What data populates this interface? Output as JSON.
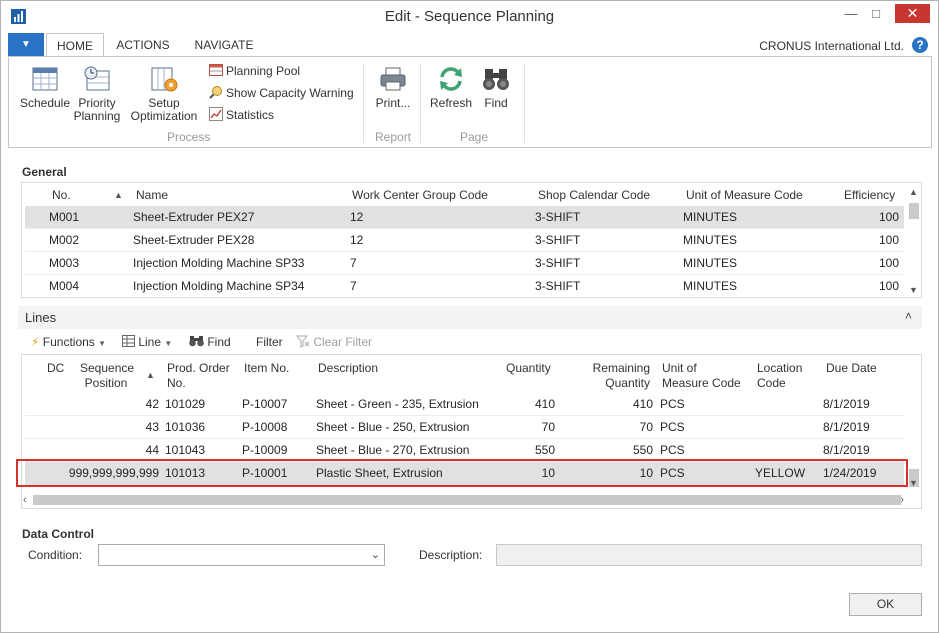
{
  "window": {
    "title": "Edit - Sequence Planning",
    "minimize_glyph": "—",
    "maximize_glyph": "□",
    "close_glyph": "✕"
  },
  "ribbon": {
    "file_glyph": "▼",
    "tabs": [
      "HOME",
      "ACTIONS",
      "NAVIGATE"
    ],
    "company": "CRONUS International Ltd.",
    "help_glyph": "?",
    "process": {
      "schedule": "Schedule",
      "priority_line1": "Priority",
      "priority_line2": "Planning",
      "setup_line1": "Setup",
      "setup_line2": "Optimization",
      "planning_pool": "Planning Pool",
      "show_capacity_warning": "Show Capacity Warning",
      "statistics": "Statistics",
      "group_label": "Process"
    },
    "report": {
      "print": "Print...",
      "group_label": "Report"
    },
    "page": {
      "refresh": "Refresh",
      "find": "Find",
      "group_label": "Page"
    }
  },
  "general": {
    "title": "General",
    "columns": [
      "No.",
      "Name",
      "Work Center Group Code",
      "Shop Calendar Code",
      "Unit of Measure Code",
      "Efficiency"
    ],
    "rows": [
      {
        "no": "M001",
        "name": "Sheet-Extruder PEX27",
        "wcg": "12",
        "cal": "3-SHIFT",
        "uom": "MINUTES",
        "eff": "100"
      },
      {
        "no": "M002",
        "name": "Sheet-Extruder PEX28",
        "wcg": "12",
        "cal": "3-SHIFT",
        "uom": "MINUTES",
        "eff": "100"
      },
      {
        "no": "M003",
        "name": "Injection Molding Machine SP33",
        "wcg": "7",
        "cal": "3-SHIFT",
        "uom": "MINUTES",
        "eff": "100"
      },
      {
        "no": "M004",
        "name": "Injection Molding Machine SP34",
        "wcg": "7",
        "cal": "3-SHIFT",
        "uom": "MINUTES",
        "eff": "100"
      }
    ]
  },
  "lines": {
    "title": "Lines",
    "collapse_glyph": "˄",
    "toolbar": {
      "functions": "Functions",
      "line": "Line",
      "find": "Find",
      "filter": "Filter",
      "clear_filter": "Clear Filter"
    },
    "columns": {
      "dc": "DC",
      "seq_line1": "Sequence",
      "seq_line2": "Position",
      "prod_line1": "Prod. Order",
      "prod_line2": "No.",
      "item": "Item No.",
      "desc": "Description",
      "qty": "Quantity",
      "rem_line1": "Remaining",
      "rem_line2": "Quantity",
      "uom_line1": "Unit of",
      "uom_line2": "Measure Code",
      "loc_line1": "Location",
      "loc_line2": "Code",
      "due": "Due Date"
    },
    "rows": [
      {
        "dc": "",
        "seq": "42",
        "prod": "101029",
        "item": "P-10007",
        "desc": "Sheet - Green - 235, Extrusion",
        "qty": "410",
        "rem": "410",
        "uom": "PCS",
        "loc": "",
        "due": "8/1/2019"
      },
      {
        "dc": "",
        "seq": "43",
        "prod": "101036",
        "item": "P-10008",
        "desc": "Sheet - Blue - 250, Extrusion",
        "qty": "70",
        "rem": "70",
        "uom": "PCS",
        "loc": "",
        "due": "8/1/2019"
      },
      {
        "dc": "",
        "seq": "44",
        "prod": "101043",
        "item": "P-10009",
        "desc": "Sheet - Blue - 270, Extrusion",
        "qty": "550",
        "rem": "550",
        "uom": "PCS",
        "loc": "",
        "due": "8/1/2019"
      },
      {
        "dc": "",
        "seq": "999,999,999,999",
        "prod": "101013",
        "item": "P-10001",
        "desc": "Plastic Sheet, Extrusion",
        "qty": "10",
        "rem": "10",
        "uom": "PCS",
        "loc": "YELLOW",
        "due": "1/24/2019"
      }
    ]
  },
  "data_control": {
    "title": "Data Control",
    "condition_label": "Condition:",
    "condition_value": "",
    "description_label": "Description:",
    "description_value": ""
  },
  "ok_label": "OK",
  "colors": {
    "accent": "#2a73c4",
    "close": "#c7372f",
    "highlight_border": "#d9302c",
    "selected_row": "#e1e1e1"
  }
}
